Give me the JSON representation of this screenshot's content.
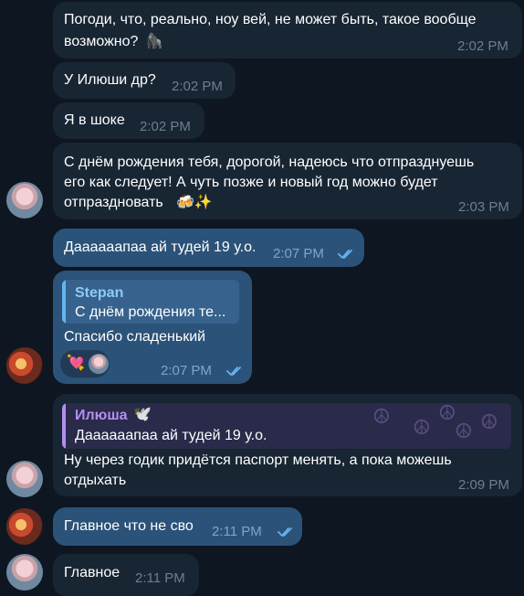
{
  "messages": [
    {
      "text_line1": "Погоди, что, реально, ноу вей, не может быть, такое вообще",
      "text_line2": "возможно?",
      "emoji": "🦍",
      "time": "2:02 PM"
    },
    {
      "text": "У Илюши др?",
      "time": "2:02 PM"
    },
    {
      "text": "Я в шоке",
      "time": "2:02 PM"
    },
    {
      "text_line1": "С днём рождения тебя, дорогой, надеюсь что отпразднуешь",
      "text_line2": "его как следует! А чуть позже и новый год можно будет",
      "text_line3": "отпраздновать",
      "emoji": "🍻✨",
      "time": "2:03 PM"
    },
    {
      "text": "Даааааапаа ай тудей 19 у.о.",
      "time": "2:07 PM"
    },
    {
      "reply_author": "Stepan",
      "reply_text": "С днём рождения те...",
      "text": "Спасибо сладенький",
      "reaction_emoji": "💘",
      "time": "2:07 PM"
    },
    {
      "reply_author": "Илюша",
      "reply_author_emoji": "🕊️",
      "reply_text": "Даааааапаа ай тудей 19 у.о.",
      "text_line1": "Ну через годик придётся паспорт менять, а пока можешь",
      "text_line2": "отдыхать",
      "time": "2:09 PM"
    },
    {
      "text": "Главное что не сво",
      "time": "2:11 PM"
    },
    {
      "text": "Главное",
      "time": "2:11 PM"
    }
  ],
  "colors": {
    "background": "#0e1621",
    "incoming_bubble": "#182533",
    "outgoing_bubble": "#2b5278",
    "reply_name_blue": "#64b5ef",
    "reply_name_purple": "#b48ef0",
    "check_blue": "#67b3f0"
  }
}
